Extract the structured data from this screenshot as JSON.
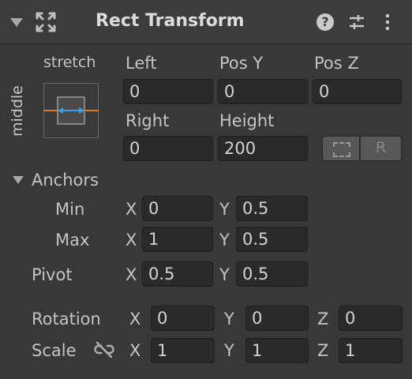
{
  "header": {
    "title": "Rect Transform",
    "component_icon": "rect-transform-icon",
    "help_icon": "question-circle-icon",
    "settings_icon": "sliders-icon",
    "menu_icon": "kebab-menu-icon",
    "help_glyph": "?"
  },
  "anchor_preset": {
    "horizontal_label": "stretch",
    "vertical_label": "middle"
  },
  "position": {
    "left_label": "Left",
    "left_value": "0",
    "pos_y_label": "Pos Y",
    "pos_y_value": "0",
    "pos_z_label": "Pos Z",
    "pos_z_value": "0",
    "right_label": "Right",
    "right_value": "0",
    "height_label": "Height",
    "height_value": "200",
    "blueprint_button_icon": "blueprint-mode-icon",
    "raw_edit_button_label": "R"
  },
  "anchors": {
    "label": "Anchors",
    "min": {
      "label": "Min",
      "x_label": "X",
      "x_value": "0",
      "y_label": "Y",
      "y_value": "0.5"
    },
    "max": {
      "label": "Max",
      "x_label": "X",
      "x_value": "1",
      "y_label": "Y",
      "y_value": "0.5"
    }
  },
  "pivot": {
    "label": "Pivot",
    "x_label": "X",
    "x_value": "0.5",
    "y_label": "Y",
    "y_value": "0.5"
  },
  "rotation": {
    "label": "Rotation",
    "x_label": "X",
    "x_value": "0",
    "y_label": "Y",
    "y_value": "0",
    "z_label": "Z",
    "z_value": "0"
  },
  "scale": {
    "label": "Scale",
    "link_icon": "unlinked-chain-icon",
    "x_label": "X",
    "x_value": "1",
    "y_label": "Y",
    "y_value": "1",
    "z_label": "Z",
    "z_value": "1"
  },
  "colors": {
    "background": "#383838",
    "header": "#3c3c3c",
    "field": "#2a2a2a",
    "anchor_orange": "#e07a2a",
    "anchor_blue": "#3aa0e8"
  }
}
